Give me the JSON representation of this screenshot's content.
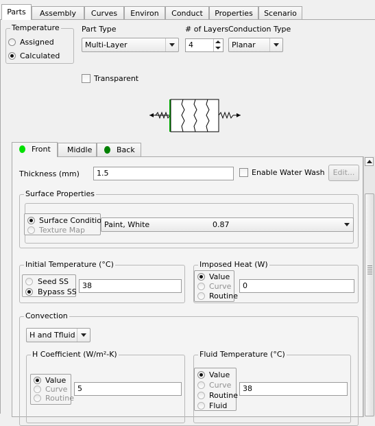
{
  "tabs": [
    "Parts",
    "Assembly",
    "Curves",
    "Environ",
    "Conduct",
    "Properties",
    "Scenario"
  ],
  "temperature": {
    "legend": "Temperature",
    "options": [
      "Assigned",
      "Calculated"
    ],
    "selected": 1
  },
  "part_type": {
    "label": "Part Type",
    "value": "Multi-Layer"
  },
  "layers": {
    "label": "# of Layers",
    "value": "4"
  },
  "conduction": {
    "label": "Conduction Type",
    "value": "Planar"
  },
  "transparent": {
    "label": "Transparent",
    "checked": false
  },
  "side_tabs": [
    {
      "label": "Front",
      "dot": "#00e000"
    },
    {
      "label": "Middle",
      "dot": ""
    },
    {
      "label": "Back",
      "dot": "#008000"
    }
  ],
  "thickness": {
    "label": "Thickness (mm)",
    "value": "1.5"
  },
  "water_wash": {
    "label": "Enable Water Wash",
    "checked": false
  },
  "edit_button": "Edit...",
  "surface": {
    "legend": "Surface Properties",
    "options": [
      "Surface Condition",
      "Texture Map"
    ],
    "selected": 0,
    "condition": "Paint, White",
    "value": "0.87"
  },
  "initial_temp": {
    "legend": "Initial Temperature (°C)",
    "options": [
      "Seed SS",
      "Bypass SS"
    ],
    "selected": 1,
    "value": "38"
  },
  "imposed_heat": {
    "legend": "Imposed Heat (W)",
    "options": [
      "Value",
      "Curve",
      "Routine"
    ],
    "selected": 0,
    "value": "0"
  },
  "convection": {
    "legend": "Convection",
    "mode": "H and Tfluid",
    "h_coeff": {
      "legend": "H Coefficient (W/m²-K)",
      "options": [
        "Value",
        "Curve",
        "Routine"
      ],
      "selected": 0,
      "value": "5"
    },
    "fluid_temp": {
      "legend": "Fluid Temperature (°C)",
      "options": [
        "Value",
        "Curve",
        "Routine",
        "Fluid"
      ],
      "selected": 0,
      "value": "38"
    }
  }
}
